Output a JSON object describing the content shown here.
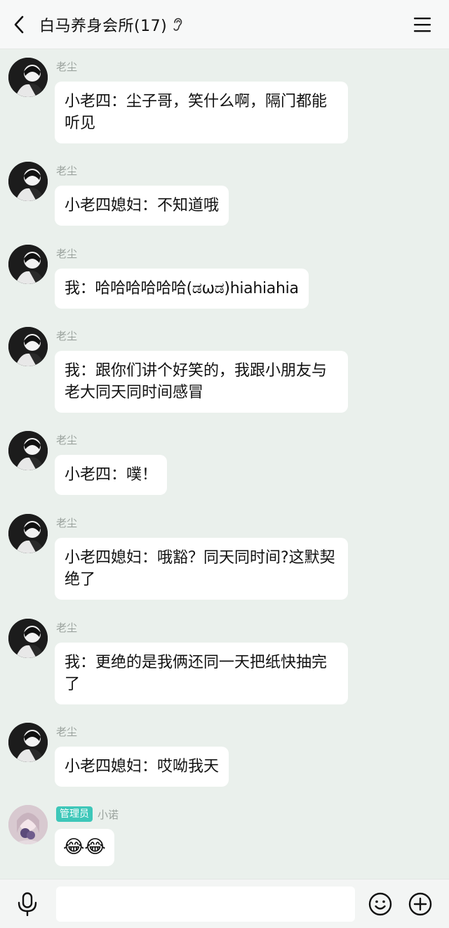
{
  "header": {
    "title": "白马养身会所(17)",
    "back_icon": "chevron-left-icon",
    "ear_icon": "ear-icon",
    "menu_icon": "hamburger-menu-icon"
  },
  "messages": [
    {
      "sender": "老尘",
      "text": "小老四：尘子哥，笑什么啊，隔门都能听见"
    },
    {
      "sender": "老尘",
      "text": "小老四媳妇：不知道哦"
    },
    {
      "sender": "老尘",
      "text": "我：哈哈哈哈哈哈(ಡωಡ)hiahiahia"
    },
    {
      "sender": "老尘",
      "text": "我：跟你们讲个好笑的，我跟小朋友与老大同天同时间感冒"
    },
    {
      "sender": "老尘",
      "text": "小老四：噗！"
    },
    {
      "sender": "老尘",
      "text": "小老四媳妇：哦豁？同天同时间?这默契绝了"
    },
    {
      "sender": "老尘",
      "text": "我：更绝的是我俩还同一天把纸快抽完了"
    },
    {
      "sender": "老尘",
      "text": "小老四媳妇：哎呦我天"
    },
    {
      "sender": "小诺",
      "badge": "管理员",
      "text": "😂😂"
    }
  ],
  "input_bar": {
    "placeholder": "",
    "mic_icon": "microphone-icon",
    "emoji_icon": "smiley-icon",
    "plus_icon": "plus-circle-icon"
  },
  "colors": {
    "background": "#eaf0ec",
    "bubble": "#ffffff",
    "sender_name": "#9aa29d",
    "admin_badge": "#3ec7b9"
  }
}
